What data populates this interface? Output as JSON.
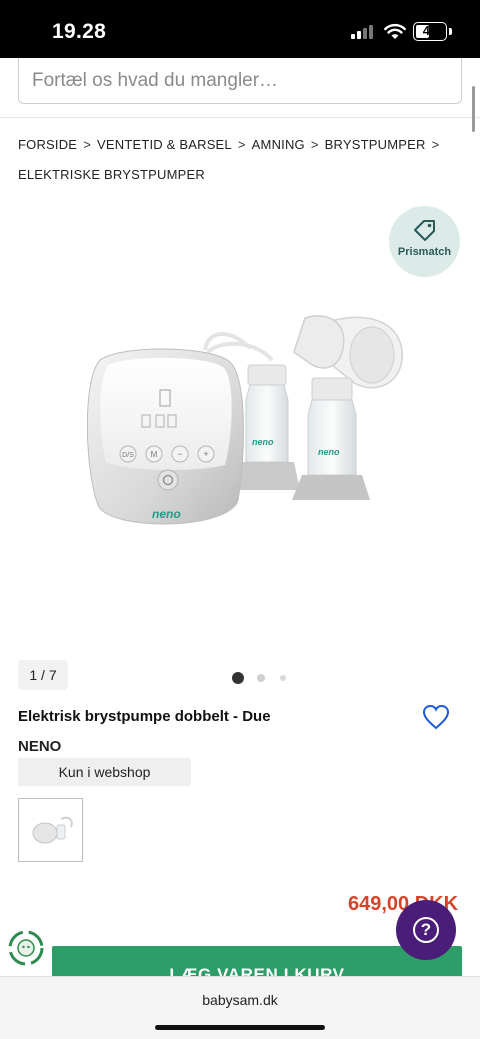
{
  "status_bar": {
    "time": "19.28",
    "battery": "45"
  },
  "search": {
    "placeholder": "Fortæl os hvad du mangler…"
  },
  "breadcrumb": {
    "items": [
      "FORSIDE",
      "VENTETID & BARSEL",
      "AMNING",
      "BRYSTPUMPER",
      "ELEKTRISKE BRYSTPUMPER"
    ],
    "separator": ">"
  },
  "prismatch": {
    "label": "Prismatch",
    "icon": "tag-icon"
  },
  "gallery": {
    "counter": "1 / 7",
    "dots_total": 3,
    "dots_active": 0,
    "device_brand_mark": "neno",
    "device_buttons": [
      "D/S",
      "M",
      "−",
      "+"
    ]
  },
  "product": {
    "title": "Elektrisk brystpumpe dobbelt - Due",
    "brand": "NENO",
    "availability": "Kun i webshop",
    "price": "649,00 DKK"
  },
  "actions": {
    "add_to_cart": "LÆG VAREN I KURV",
    "help": "?"
  },
  "browser": {
    "url": "babysam.dk"
  },
  "colors": {
    "accent_green": "#2e9e68",
    "price_red": "#d6452a",
    "help_purple": "#4a1e78",
    "prismatch_bg": "#dcebe8",
    "heart_blue": "#1c5bd6"
  }
}
